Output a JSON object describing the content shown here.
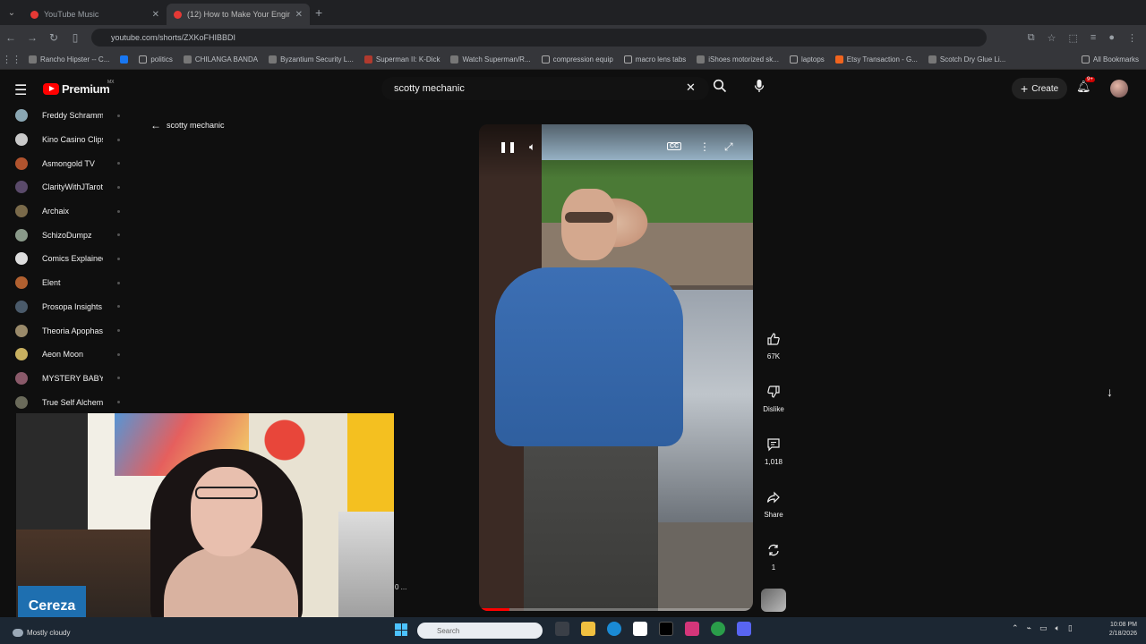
{
  "browser": {
    "tabs": [
      {
        "label": "YouTube Music",
        "active": false
      },
      {
        "label": "(12) How to Make Your Engine...",
        "active": true
      }
    ],
    "address": "youtube.com/shorts/ZXKoFHIBBDI",
    "bookmarks": [
      "Rancho Hipster -- C...",
      "politics",
      "CHILANGA BANDA",
      "Byzantium Security L...",
      "Superman II: K-Dick",
      "Watch Superman/R...",
      "compression equip",
      "macro lens tabs",
      "iShoes motorized sk...",
      "laptops",
      "Etsy Transaction - G...",
      "Scotch Dry Glue Li..."
    ],
    "bookmarks_all": "All Bookmarks"
  },
  "youtube": {
    "logo_text": "Premium",
    "logo_region": "MX",
    "search_value": "scotty mechanic",
    "create_label": "Create",
    "notification_badge": "9+",
    "back_label": "scotty mechanic"
  },
  "subscriptions": [
    {
      "name": "Freddy Schramm",
      "color": "#8aa7b3"
    },
    {
      "name": "Kino Casino Clips",
      "color": "#c9c9c9"
    },
    {
      "name": "Asmongold TV",
      "color": "#b0532e"
    },
    {
      "name": "ClarityWithJTarot",
      "color": "#5a4a6a"
    },
    {
      "name": "Archaix",
      "color": "#7a6a4a"
    },
    {
      "name": "SchizoDumpz",
      "color": "#8a9a8a"
    },
    {
      "name": "Comics Explained",
      "color": "#dddddd"
    },
    {
      "name": "Elent",
      "color": "#b06030"
    },
    {
      "name": "Prosopa Insights",
      "color": "#4a5a6a"
    },
    {
      "name": "Theoria Apophas...",
      "color": "#9a8a6a"
    },
    {
      "name": "Aeon Moon",
      "color": "#c8b060"
    },
    {
      "name": "MYSTERY BABYLON",
      "color": "#8a5a6a"
    },
    {
      "name": "True Self Alchem...",
      "color": "#6a6a5a"
    }
  ],
  "actions": {
    "like_count": "67K",
    "dislike_label": "Dislike",
    "comments_count": "1,018",
    "share_label": "Share",
    "remix_count": "1"
  },
  "player": {
    "cc_label": "CC",
    "progress": 0.11
  },
  "overlay": {
    "name_badge": "Cereza",
    "caption_fragment": "0 ..."
  },
  "taskbar": {
    "weather": "Mostly cloudy",
    "search_placeholder": "Search",
    "time": "10:08 PM",
    "date": "2/18/2026"
  }
}
